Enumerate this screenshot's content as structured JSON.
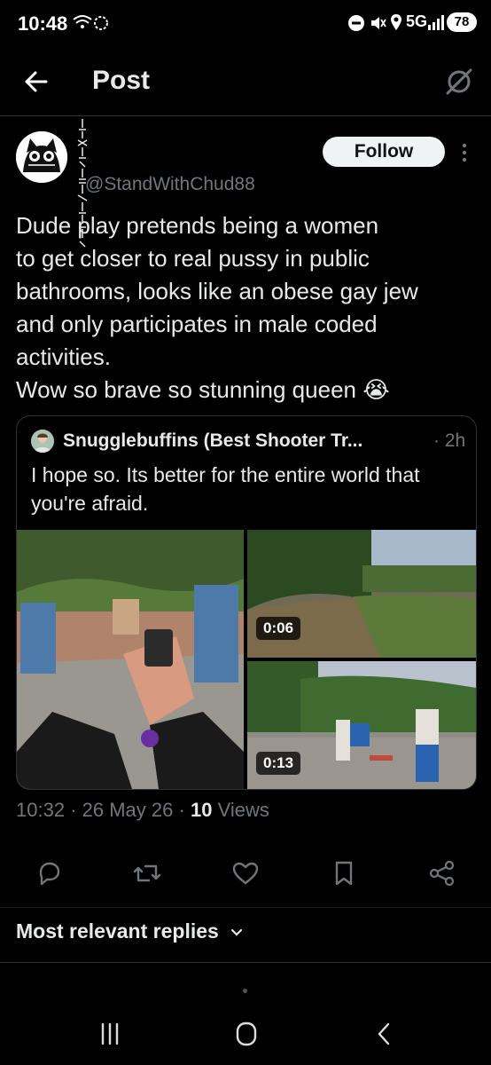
{
  "status_bar": {
    "time": "10:48",
    "network": "5G",
    "battery": "78"
  },
  "header": {
    "back_icon": "arrow-left-icon",
    "title": "Post",
    "grok_icon": "grok-icon"
  },
  "author": {
    "handle": "@StandWithChud88",
    "follow_label": "Follow"
  },
  "post": {
    "lines": [
      "Dude play pretends being a women",
      "to get closer to real pussy in public",
      "bathrooms, looks like an obese gay jew",
      "and only participates in male coded",
      "activities.",
      "Wow so brave so stunning queen 😭"
    ]
  },
  "quote": {
    "name": "Snugglebuffins (Best Shooter Tr...",
    "time": "· 2h",
    "text": "I hope so. Its better for the entire world that you're afraid.",
    "media": [
      {
        "kind": "video-frame"
      },
      {
        "kind": "video",
        "duration": "0:06"
      },
      {
        "kind": "video",
        "duration": "0:13"
      }
    ]
  },
  "meta": {
    "time": "10:32",
    "date": "26 May 26",
    "views_count": "10",
    "views_label": "Views",
    "sep": "·"
  },
  "actions": [
    "reply-icon",
    "repost-icon",
    "like-icon",
    "bookmark-icon",
    "share-icon"
  ],
  "replies": {
    "sort_label": "Most relevant replies"
  },
  "colors": {
    "background": "#000000",
    "text": "#e7e9ea",
    "muted": "#71767b",
    "border": "#2f3336",
    "follow_bg": "#eff3f4"
  }
}
